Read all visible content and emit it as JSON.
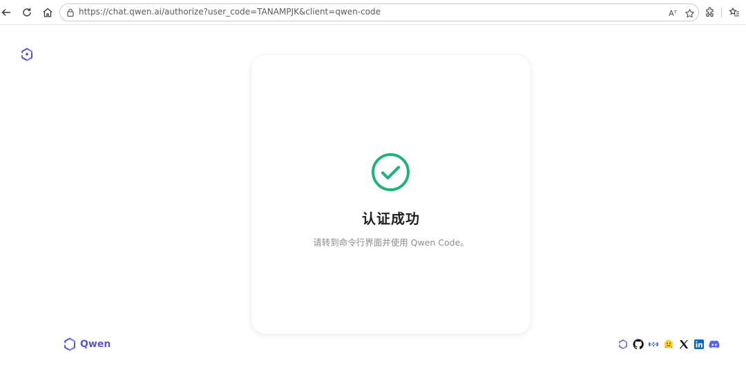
{
  "browser": {
    "url": "https://chat.qwen.ai/authorize?user_code=TANAMPJK&client=qwen-code",
    "read_aloud_label": "Aᵀ"
  },
  "page": {
    "brand_name": "Qwen"
  },
  "card": {
    "title": "认证成功",
    "subtitle": "请转到命令行界面并使用 Qwen Code。"
  },
  "colors": {
    "success": "#1db37a",
    "brand": "#5b55c7"
  },
  "footer": {
    "social_icons": [
      "qwen-icon",
      "github-icon",
      "modelscope-icon",
      "huggingface-icon",
      "x-icon",
      "linkedin-icon",
      "discord-icon"
    ]
  }
}
